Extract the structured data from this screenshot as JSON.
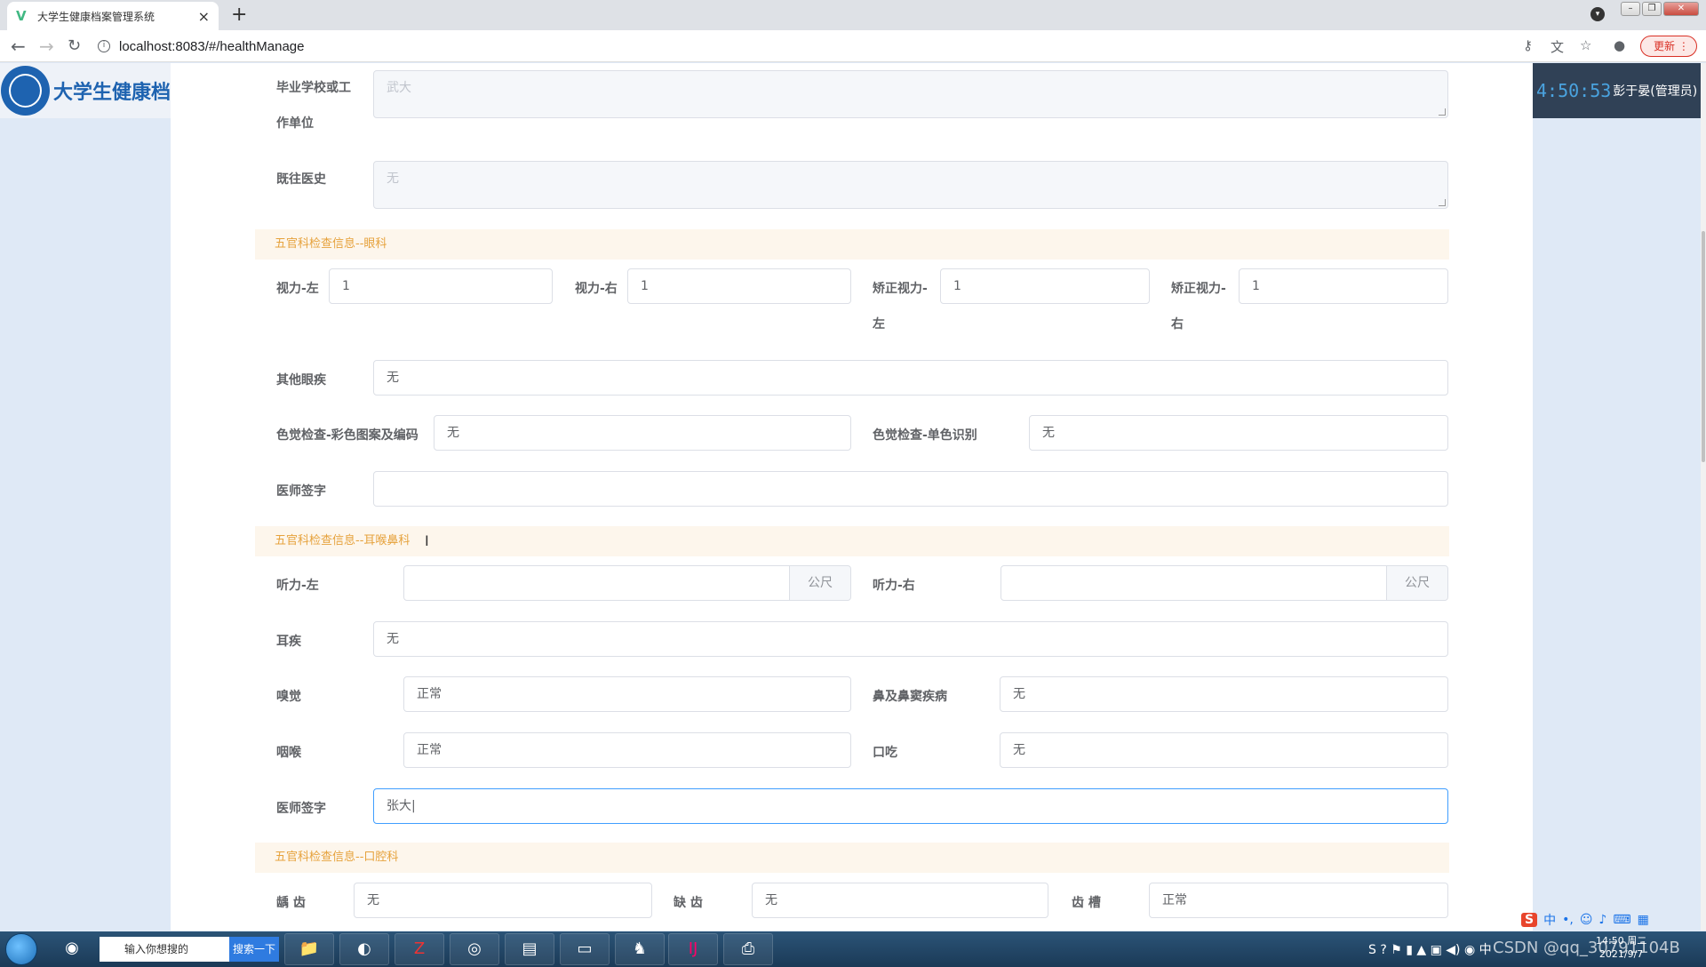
{
  "browser": {
    "tab_title": "大学生健康档案管理系统",
    "tab_close": "×",
    "new_tab": "+",
    "url": "localhost:8083/#/healthManage",
    "update_label": "更新"
  },
  "app": {
    "logo_text": "大学生健康档",
    "clock": "4:50:53",
    "user": "彭于晏(管理员) ∨"
  },
  "form": {
    "school_label_1": "毕业学校或工",
    "school_label_2": "作单位",
    "school_value": "武大",
    "history_label": "既往医史",
    "history_value": "无",
    "eye": {
      "section": "五官科检查信息--眼科",
      "vision_left_label": "视力-左",
      "vision_left": "1",
      "vision_right_label": "视力-右",
      "vision_right": "1",
      "corrected_left_label_1": "矫正视力-",
      "corrected_left_label_2": "左",
      "corrected_left": "1",
      "corrected_right_label_1": "矫正视力-",
      "corrected_right_label_2": "右",
      "corrected_right": "1",
      "other_label": "其他眼疾",
      "other_value": "无",
      "color_pattern_label": "色觉检查-彩色图案及编码",
      "color_pattern": "无",
      "color_single_label": "色觉检查-单色识别",
      "color_single": "无",
      "doctor_label": "医师签字",
      "doctor_value": ""
    },
    "ent": {
      "section": "五官科检查信息--耳喉鼻科",
      "hearing_left_label": "听力-左",
      "hearing_left": "",
      "hearing_right_label": "听力-右",
      "hearing_right": "",
      "unit": "公尺",
      "ear_label": "耳疾",
      "ear_value": "无",
      "smell_label": "嗅觉",
      "smell_value": "正常",
      "nose_label": "鼻及鼻窦疾病",
      "nose_value": "无",
      "throat_label": "咽喉",
      "throat_value": "正常",
      "stutter_label": "口吃",
      "stutter_value": "无",
      "doctor_label": "医师签字",
      "doctor_value": "张大|"
    },
    "oral": {
      "section": "五官科检查信息--口腔科",
      "caries_label": "龋 齿",
      "caries_value": "无",
      "missing_label": "缺 齿",
      "missing_value": "无",
      "gum_label": "齿 槽",
      "gum_value": "正常"
    }
  },
  "taskbar": {
    "search_placeholder": "输入你想搜的",
    "search_button": "搜索一下",
    "tray_time": "14:50 周二",
    "tray_date": "2021/9/7",
    "watermark": "CSDN @qq_30791104B"
  },
  "colors": {
    "primary": "#409eff",
    "section_bg": "#fdf6ec",
    "section_text": "#e6a23c",
    "header_dark": "#304156"
  }
}
